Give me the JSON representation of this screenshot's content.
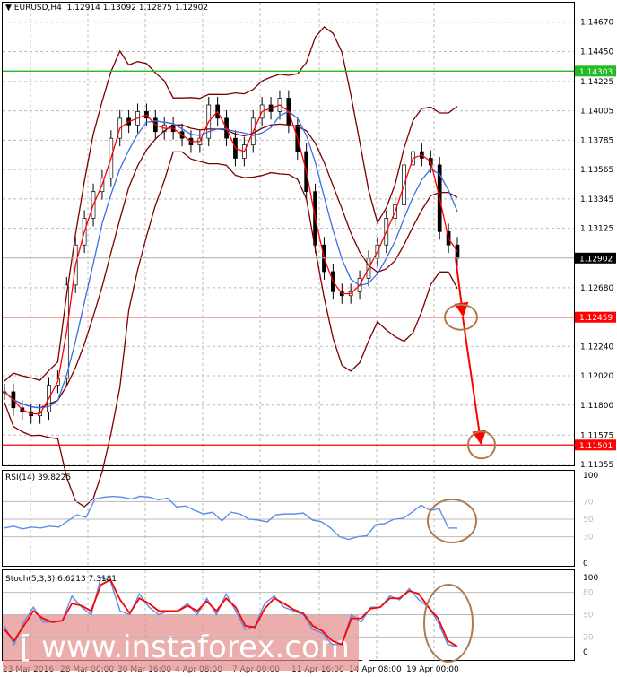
{
  "header": {
    "symbol": "EURUSD,H4",
    "ohlc": "1.12914 1.13092 1.12875 1.12902"
  },
  "colors": {
    "candles": "#000000",
    "ma_fast": "#ff0000",
    "ma_slow": "#3a6fe0",
    "bands": "#7a0000",
    "support": "#ff0000",
    "resistance": "#22bb22",
    "arrow": "#ff0000",
    "circle": "#b07a50",
    "rsi": "#5b8ee6",
    "stoch_k": "#5b8ee6",
    "stoch_d": "#ff0000"
  },
  "chart_data": [
    {
      "type": "candlestick",
      "title": "EURUSD,H4",
      "ylim": [
        1.11355,
        1.1467
      ],
      "y_ticks": [
        "1.14670",
        "1.14450",
        "1.14225",
        "1.14005",
        "1.13785",
        "1.13565",
        "1.13345",
        "1.13125",
        "1.12680",
        "1.12240",
        "1.12020",
        "1.11800",
        "1.11575",
        "1.11355"
      ],
      "x_ticks": [
        "23 Mar 2016",
        "28 Mar 00:00",
        "30 Mar 16:00",
        "4 Apr 08:00",
        "7 Apr 00:00",
        "11 Apr 16:00",
        "14 Apr 08:00",
        "19 Apr 00:00"
      ],
      "closes": [
        1.119,
        1.1178,
        1.1175,
        1.1172,
        1.1175,
        1.1195,
        1.12,
        1.127,
        1.13,
        1.132,
        1.134,
        1.135,
        1.138,
        1.1395,
        1.139,
        1.14,
        1.1395,
        1.1385,
        1.139,
        1.1385,
        1.138,
        1.1375,
        1.138,
        1.1405,
        1.1395,
        1.138,
        1.1365,
        1.1375,
        1.1395,
        1.1405,
        1.14,
        1.141,
        1.139,
        1.137,
        1.134,
        1.13,
        1.128,
        1.1265,
        1.1262,
        1.1265,
        1.1275,
        1.129,
        1.13,
        1.132,
        1.133,
        1.136,
        1.137,
        1.1365,
        1.136,
        1.131,
        1.13,
        1.129
      ],
      "levels": [
        {
          "price": 1.14303,
          "label": "1.14303",
          "kind": "resistance"
        },
        {
          "price": 1.12459,
          "label": "1.12459",
          "kind": "support"
        },
        {
          "price": 1.11501,
          "label": "1.11501",
          "kind": "support"
        }
      ],
      "current_price": {
        "price": 1.12902,
        "label": "1.12902"
      },
      "forecast_arrow": [
        1.12902,
        1.12459,
        1.11501
      ]
    },
    {
      "type": "line",
      "title": "RSI(14) 39.8225",
      "ylim": [
        0,
        100
      ],
      "y_ticks": [
        "100",
        "70",
        "50",
        "30",
        "0"
      ],
      "values": [
        40,
        42,
        39,
        41,
        40,
        42,
        41,
        48,
        55,
        52,
        73,
        75,
        76,
        75,
        73,
        76,
        75,
        72,
        74,
        64,
        65,
        60,
        56,
        58,
        48,
        58,
        56,
        50,
        49,
        47,
        55,
        56,
        56,
        57,
        49,
        47,
        40,
        30,
        27,
        30,
        31,
        44,
        45,
        50,
        51,
        58,
        66,
        60,
        62,
        40,
        39.8
      ]
    },
    {
      "type": "line",
      "title": "Stoch(5,3,3) 6.6213 7.3181",
      "ylim": [
        0,
        100
      ],
      "y_ticks": [
        "100",
        "80",
        "50",
        "20",
        "0"
      ],
      "series": [
        {
          "values": [
            35,
            10,
            40,
            60,
            40,
            40,
            42,
            75,
            60,
            50,
            100,
            95,
            55,
            50,
            78,
            60,
            50,
            55,
            55,
            65,
            50,
            72,
            50,
            78,
            55,
            30,
            35,
            65,
            75,
            60,
            55,
            50,
            30,
            25,
            10,
            10,
            50,
            40,
            60,
            60,
            75,
            70,
            85,
            70,
            60,
            40,
            10,
            6.6
          ]
        },
        {
          "values": [
            30,
            15,
            35,
            55,
            45,
            40,
            42,
            65,
            62,
            55,
            90,
            97,
            70,
            52,
            72,
            65,
            55,
            55,
            55,
            62,
            55,
            68,
            55,
            72,
            60,
            35,
            33,
            58,
            72,
            65,
            57,
            52,
            35,
            28,
            15,
            10,
            45,
            45,
            58,
            60,
            72,
            72,
            82,
            78,
            60,
            45,
            15,
            7.3
          ]
        }
      ]
    }
  ],
  "watermark": "[  www.instaforex.com  ]"
}
